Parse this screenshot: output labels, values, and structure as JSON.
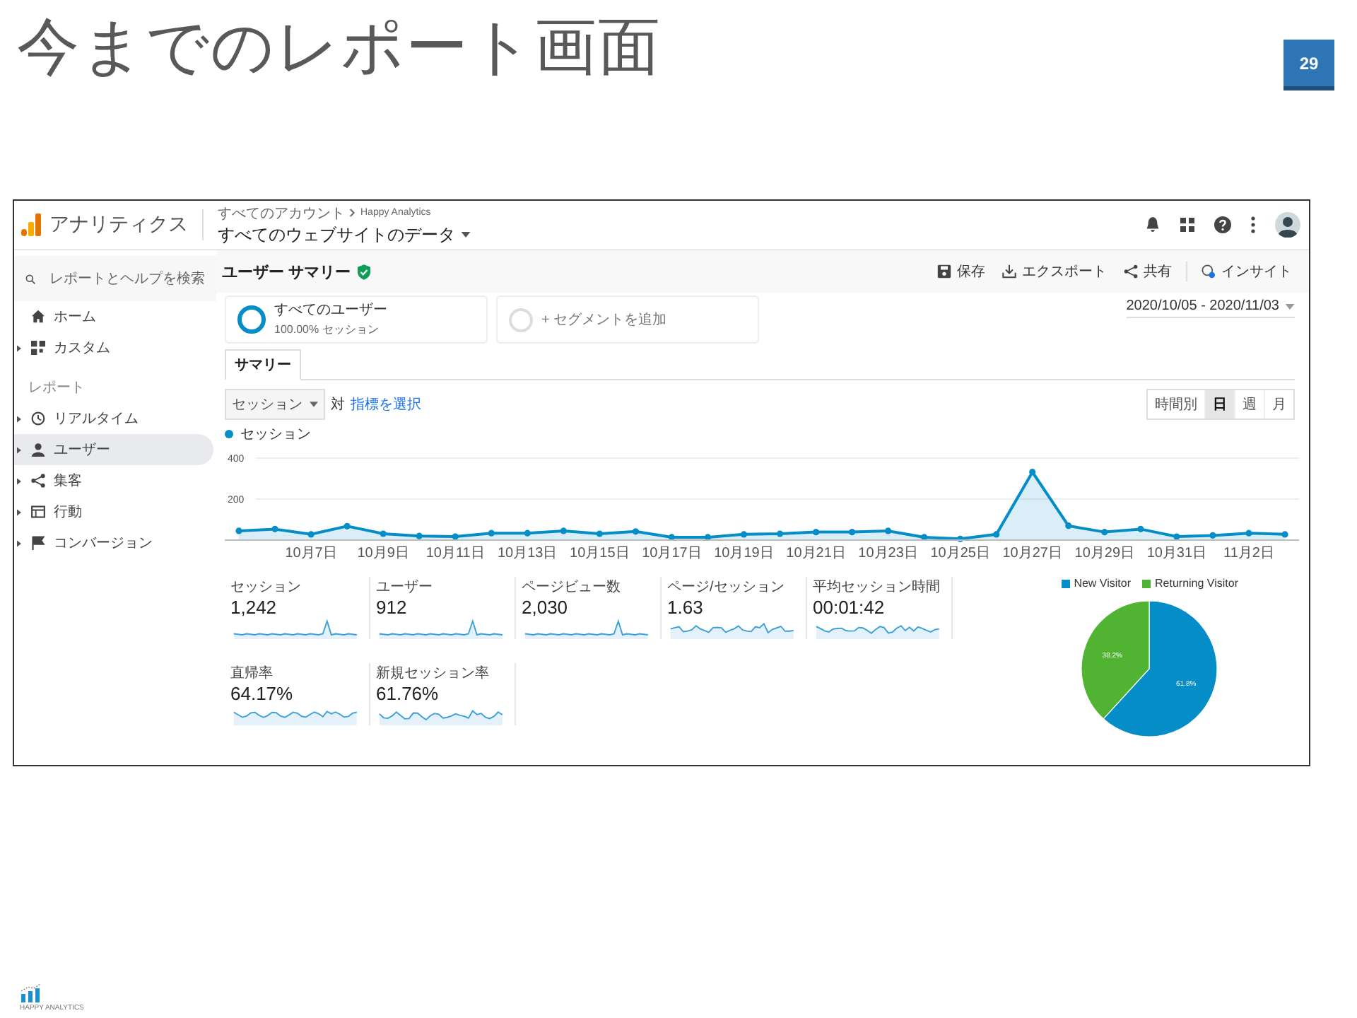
{
  "slide": {
    "title": "今までのレポート画面",
    "page_number": "29"
  },
  "app": {
    "product": "アナリティクス",
    "breadcrumb": [
      "すべてのアカウント",
      "Happy Analytics"
    ],
    "view": "すべてのウェブサイトのデータ"
  },
  "search": {
    "placeholder": "レポートとヘルプを検索"
  },
  "sidebar": {
    "items": [
      {
        "kind": "link",
        "label": "ホーム",
        "selected": false
      },
      {
        "kind": "group",
        "label": "カスタム",
        "selected": false,
        "expanded": false
      },
      {
        "kind": "heading",
        "label": "レポート"
      },
      {
        "kind": "group",
        "label": "リアルタイム",
        "selected": false,
        "expanded": false
      },
      {
        "kind": "group",
        "label": "ユーザー",
        "selected": true,
        "expanded": false
      },
      {
        "kind": "group",
        "label": "集客",
        "selected": false,
        "expanded": false
      },
      {
        "kind": "group",
        "label": "行動",
        "selected": false,
        "expanded": false
      },
      {
        "kind": "group",
        "label": "コンバージョン",
        "selected": false,
        "expanded": false
      }
    ]
  },
  "report": {
    "title": "ユーザー サマリー",
    "verified": true
  },
  "actions": [
    {
      "label": "保存"
    },
    {
      "label": "エクスポート"
    },
    {
      "label": "共有"
    },
    {
      "label": "インサイト"
    }
  ],
  "segments": [
    {
      "kind": "active",
      "title": "すべてのユーザー",
      "subtitle": "100.00% セッション"
    },
    {
      "kind": "add",
      "title": "+ セグメントを追加"
    }
  ],
  "date_range": "2020/10/05 - 2020/11/03",
  "tabs": [
    {
      "label": "サマリー",
      "selected": true
    }
  ],
  "metric_select": {
    "value": "セッション",
    "versus": "対",
    "link": "指標を選択"
  },
  "intervals": [
    {
      "label": "時間別",
      "selected": false
    },
    {
      "label": "日",
      "selected": true
    },
    {
      "label": "週",
      "selected": false
    },
    {
      "label": "月",
      "selected": false
    }
  ],
  "chart": {
    "chart_data": {
      "type": "area",
      "categories": [
        null,
        null,
        "10月7日",
        null,
        "10月9日",
        null,
        "10月11日",
        null,
        "10月13日",
        null,
        "10月15日",
        null,
        "10月17日",
        null,
        "10月19日",
        null,
        "10月21日",
        null,
        "10月23日",
        null,
        "10月25日",
        null,
        "10月27日",
        null,
        "10月29日",
        null,
        "10月31日",
        null,
        "11月2日",
        null
      ],
      "series": [
        {
          "name": "セッション",
          "color": "#058dc7",
          "values": [
            45,
            54,
            28,
            68,
            31,
            20,
            17,
            34,
            34,
            45,
            31,
            42,
            14,
            14,
            28,
            31,
            39,
            39,
            45,
            14,
            6,
            28,
            332,
            70,
            39,
            54,
            17,
            23,
            34,
            28
          ]
        }
      ],
      "ylim": [
        0,
        400
      ],
      "yticks": [
        200,
        400
      ]
    }
  },
  "metrics": [
    {
      "label": "セッション",
      "value": "1,242"
    },
    {
      "label": "ユーザー",
      "value": "912"
    },
    {
      "label": "ページビュー数",
      "value": "2,030"
    },
    {
      "label": "ページ/セッション",
      "value": "1.63"
    },
    {
      "label": "平均セッション時間",
      "value": "00:01:42"
    },
    {
      "label": "直帰率",
      "value": "64.17%"
    },
    {
      "label": "新規セッション率",
      "value": "61.76%"
    }
  ],
  "pie": {
    "slices": [
      {
        "color": "#058dc7"
      },
      {
        "color": "#50b432"
      }
    ],
    "chart_data": {
      "type": "pie",
      "legend": "top",
      "categories": [
        "New Visitor",
        "Returning Visitor"
      ],
      "values": [
        61.8,
        38.2
      ],
      "value_labels": [
        "61.8%",
        "38.2%"
      ]
    }
  },
  "footer_logo": {
    "text": "HAPPY ANALYTICS"
  }
}
